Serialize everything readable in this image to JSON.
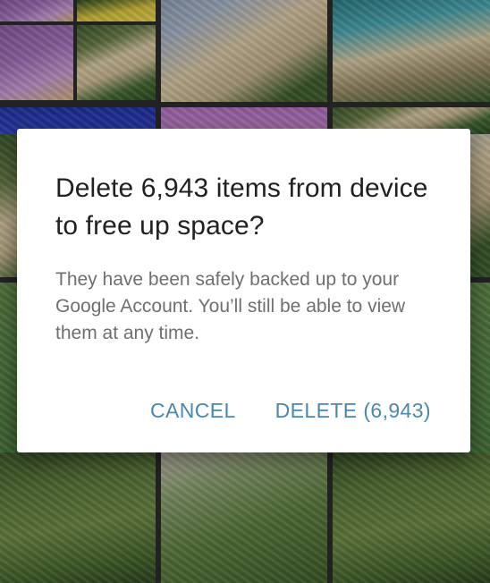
{
  "dialog": {
    "title": "Delete 6,943 items from device to free up space?",
    "message": "They have been safely backed up to your Google Account. You’ll still be able to view them at any time.",
    "cancel_label": "CANCEL",
    "delete_label": "DELETE (6,943)"
  },
  "colors": {
    "button_text": "#4a88b0",
    "title_text": "#212121",
    "body_text": "#6f6f6f"
  }
}
